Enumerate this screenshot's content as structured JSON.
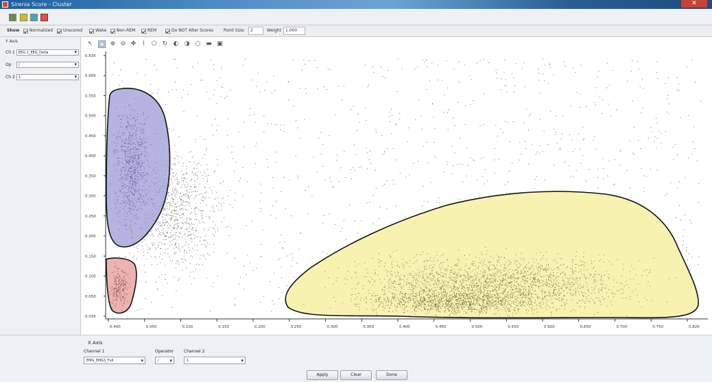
{
  "window": {
    "title": "Sirenia Score - Cluster",
    "close_glyph": "✕"
  },
  "toolbar": {
    "buttons": [
      "grid-icon",
      "open-icon",
      "export-icon",
      "delete-icon"
    ]
  },
  "display": {
    "show_label": "Show",
    "options": [
      {
        "label": "Normalized",
        "checked": true
      },
      {
        "label": "Unscored",
        "checked": true
      },
      {
        "label": "Wake",
        "checked": true
      },
      {
        "label": "Non-REM",
        "checked": true
      },
      {
        "label": "REM",
        "checked": true
      },
      {
        "label": "Do NOT Alter Scores",
        "checked": true
      }
    ],
    "point_size_label": "Point Size:",
    "point_size_value": "2",
    "weight_label": "Weight",
    "weight_value": "1.000"
  },
  "y_axis_panel": {
    "header": "Y Axis",
    "ch1_label": "Ch 1",
    "ch1_value": "EEG 2_EEG_Delta",
    "op_label": "Op",
    "op_value": "/",
    "ch2_label": "Ch 2",
    "ch2_value": "1"
  },
  "plot_tools": [
    "pointer-icon",
    "zoom-box-icon",
    "zoom-in-icon",
    "zoom-out-icon",
    "pan-icon",
    "lasso-icon",
    "polygon-icon",
    "reset-icon",
    "prev-icon",
    "next-icon",
    "info-icon",
    "print-icon",
    "save-icon"
  ],
  "plot": {
    "y_ticks": [
      "0.635",
      "0.600",
      "0.550",
      "0.500",
      "0.450",
      "0.400",
      "0.350",
      "0.300",
      "0.250",
      "0.200",
      "0.150",
      "0.100",
      "0.050",
      "0.035"
    ],
    "x_ticks": [
      "0.400",
      "0.050",
      "0.100",
      "0.150",
      "0.200",
      "0.250",
      "0.300",
      "0.350",
      "0.400",
      "0.450",
      "0.500",
      "0.550",
      "0.600",
      "0.650",
      "0.700",
      "0.750",
      "0.820"
    ],
    "colors": {
      "wake": "#9f9fd8",
      "rem": "#e8a3a0",
      "nrem": "#f6f0a2",
      "points": "#6a6a6a"
    }
  },
  "x_axis_panel": {
    "header": "X Axis",
    "ch1_label": "Channel 1",
    "ch1_value": "EMG_EMG1_Full",
    "op_label": "Operator",
    "op_value": "/",
    "ch2_label": "Channel 2",
    "ch2_value": "1"
  },
  "buttons": {
    "apply": "Apply",
    "clear": "Clear",
    "done": "Done"
  }
}
